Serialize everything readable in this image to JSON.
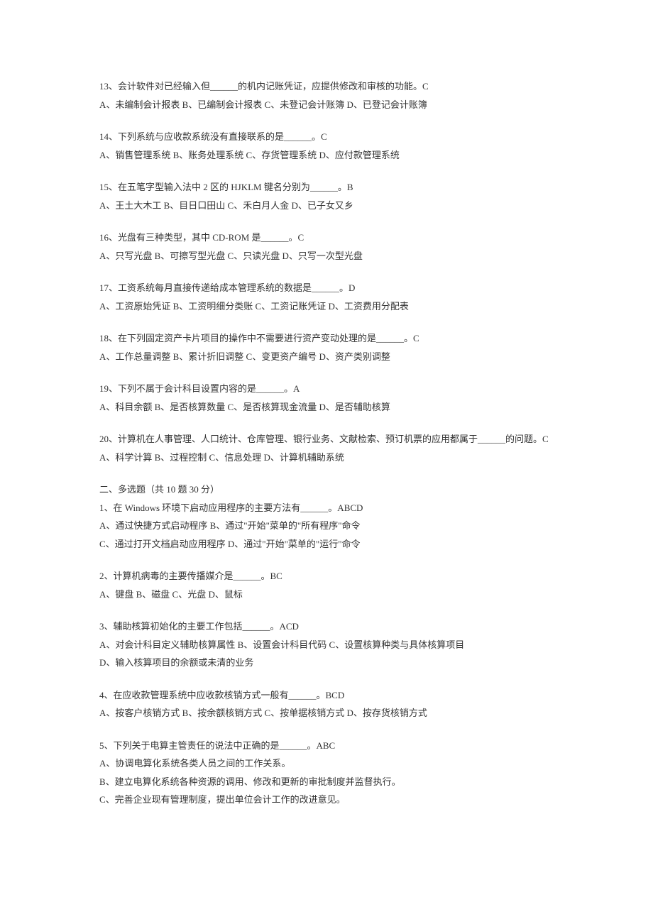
{
  "questions": [
    {
      "stem": "13、会计软件对已经输入但______的机内记账凭证，应提供修改和审核的功能。C",
      "opts": [
        "A、未编制会计报表  B、已编制会计报表 C、未登记会计账簿 D、已登记会计账簿"
      ]
    },
    {
      "stem": "14、下列系统与应收款系统没有直接联系的是______。C",
      "opts": [
        "A、销售管理系统 B、账务处理系统 C、存货管理系统 D、应付款管理系统"
      ]
    },
    {
      "stem": "15、在五笔字型输入法中 2 区的 HJKLM  键名分别为______。B",
      "opts": [
        "A、王土大木工 B、目日口田山 C、禾白月人金 D、已子女又乡"
      ]
    },
    {
      "stem": "16、光盘有三种类型，其中 CD-ROM 是______。C",
      "opts": [
        "A、只写光盘 B、可擦写型光盘 C、只读光盘 D、只写一次型光盘"
      ]
    },
    {
      "stem": "17、工资系统每月直接传递给成本管理系统的数据是______。D",
      "opts": [
        "A、工资原始凭证 B、工资明细分类账 C、工资记账凭证 D、工资费用分配表"
      ]
    },
    {
      "stem": "18、在下列固定资产卡片项目的操作中不需要进行资产变动处理的是______。C",
      "opts": [
        "A、工作总量调整  B、累计折旧调整 C、变更资产编号 D、资产类别调整"
      ]
    },
    {
      "stem": "19、下列不属于会计科目设置内容的是______。A",
      "opts": [
        "A、科目余额 B、是否核算数量 C、是否核算现金流量 D、是否辅助核算"
      ]
    },
    {
      "stem": "20、计算机在人事管理、人口统计、仓库管理、银行业务、文献检索、预订机票的应用都属于______的问题。C",
      "opts": [
        "A、科学计算 B、过程控制 C、信息处理 D、计算机辅助系统"
      ]
    }
  ],
  "section2": {
    "header": "二、多选题（共 10 题 30 分）",
    "questions": [
      {
        "stem": "1、在 Windows 环境下启动应用程序的主要方法有______。ABCD",
        "opts": [
          "A、通过快捷方式启动程序 B、通过\"开始\"菜单的\"所有程序\"命令",
          "C、通过打开文档启动应用程序 D、通过\"开始\"菜单的\"运行\"命令"
        ]
      },
      {
        "stem": "2、计算机病毒的主要传播媒介是______。BC",
        "opts": [
          "A、键盘 B、磁盘 C、光盘 D、鼠标"
        ]
      },
      {
        "stem": "3、辅助核算初始化的主要工作包括______。ACD",
        "opts": [
          "A、对会计科目定义辅助核算属性 B、设置会计科目代码 C、设置核算种类与具体核算项目",
          "D、输入核算项目的余额或未清的业务"
        ]
      },
      {
        "stem": "4、在应收款管理系统中应收款核销方式一般有______。BCD",
        "opts": [
          "A、按客户核销方式 B、按余额核销方式 C、按单据核销方式 D、按存货核销方式"
        ]
      },
      {
        "stem": "5、下列关于电算主管责任的说法中正确的是______。ABC",
        "opts": [
          "A、协调电算化系统各类人员之间的工作关系。",
          "B、建立电算化系统各种资源的调用、修改和更新的审批制度并监督执行。",
          "C、完善企业现有管理制度，提出单位会计工作的改进意见。"
        ]
      }
    ]
  }
}
